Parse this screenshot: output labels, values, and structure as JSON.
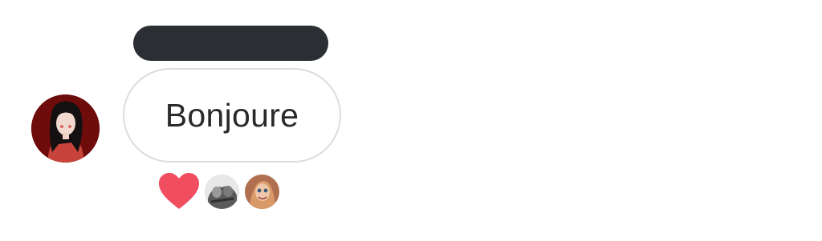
{
  "message": {
    "text": "Bonjoure"
  },
  "reactions": {
    "emoji": "heart-icon",
    "count_avatars": 2
  },
  "colors": {
    "sender_bar": "#2b2f33",
    "heart": "#f04d5f",
    "bubble_border": "#dcdcdc",
    "text": "#2a2a2a"
  }
}
